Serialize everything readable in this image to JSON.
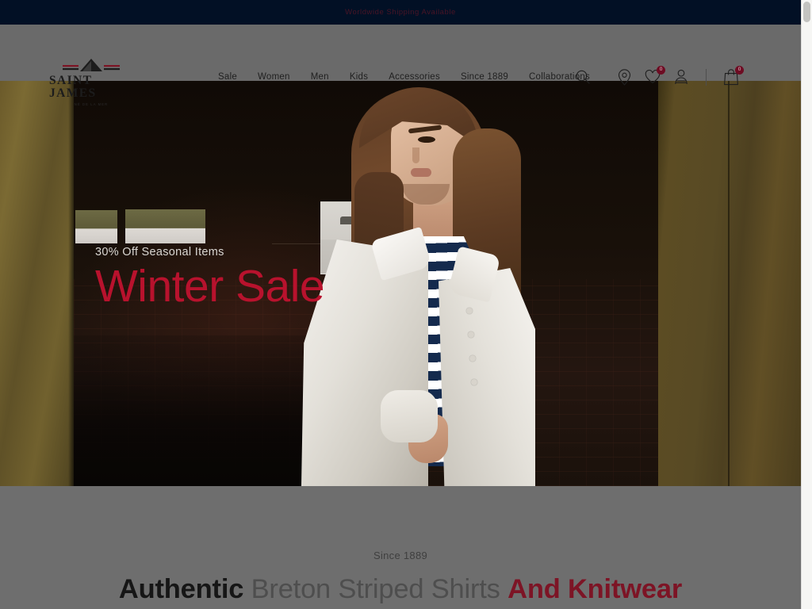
{
  "announcement": {
    "text": "Worldwide Shipping Available"
  },
  "header": {
    "logo": {
      "name": "SAINT JAMES",
      "tagline": "NÉ DE LA MER",
      "icon": "boat-sail-logo-icon"
    },
    "nav": [
      {
        "label": "Sale"
      },
      {
        "label": "Women"
      },
      {
        "label": "Men"
      },
      {
        "label": "Kids"
      },
      {
        "label": "Accessories"
      },
      {
        "label": "Since 1889"
      },
      {
        "label": "Collaborations"
      }
    ],
    "search_icon": "search-icon",
    "icons": [
      {
        "name": "store-locator-icon",
        "badge": null
      },
      {
        "name": "wishlist-heart-icon",
        "badge": "0"
      },
      {
        "name": "account-person-icon",
        "badge": null
      },
      {
        "name": "shopping-bag-icon",
        "badge": "0"
      }
    ]
  },
  "hero": {
    "eyebrow": "30% Off Seasonal Items",
    "title": "Winter Sale",
    "title_color": "#b8122d",
    "image_alt": "Woman wearing white jacket over navy Breton striped shirt and denim skirt in a doorway"
  },
  "intro": {
    "kicker": "Since 1889",
    "heading_part1": "Authentic",
    "heading_part2": "Breton Striped Shirts",
    "heading_part3": "And",
    "heading_part4": "Knitwear"
  },
  "colors": {
    "banner_bg": "#021025",
    "accent_red": "#b8122d",
    "badge_bg": "#6e0c23",
    "page_overlay": "#6e6e6e"
  }
}
